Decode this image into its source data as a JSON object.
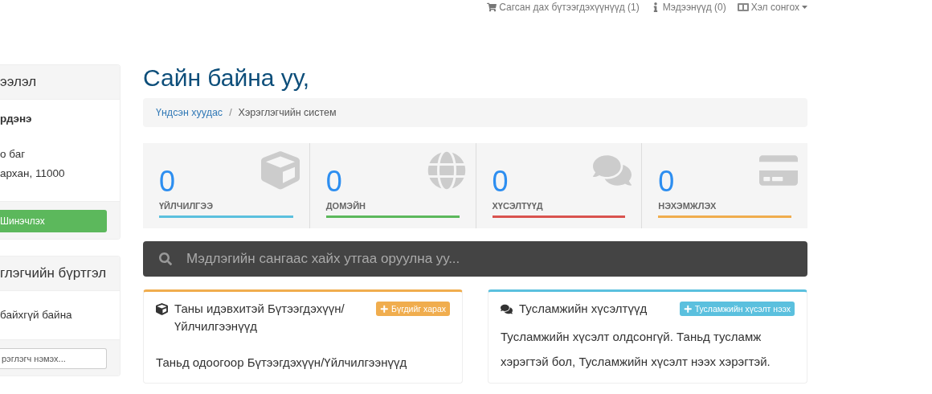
{
  "top_nav": [
    {
      "kind": "cart",
      "label": "Сагсан дах бүтээгдэхүүнүүд (1)"
    },
    {
      "kind": "news",
      "label": "Мэдээнүүд (0)"
    },
    {
      "kind": "language",
      "label": "Хэл сонгох"
    }
  ],
  "sidebar": {
    "info_panel": {
      "title": "ээлэл",
      "lines": [
        "рдэнэ"
      ],
      "address": [
        "о баг",
        "архан, 11000"
      ],
      "button": "Шинэчлэх"
    },
    "contacts_panel": {
      "title": "глэгчийн бүртгэл",
      "body": "байхгүй байна",
      "input_placeholder": "рэглэгч нэмэх..."
    }
  },
  "heading": "Сайн байна уу,",
  "breadcrumb": [
    {
      "label": "Үндсэн хуудас",
      "selected": false
    },
    {
      "separator": "/",
      "label": "Хэрэглэгчийн систем",
      "selected": true
    }
  ],
  "stats": [
    {
      "kind": "box",
      "value": "0",
      "label": "ҮЙЛЧИЛГЭЭ",
      "color": "#5bc0de"
    },
    {
      "kind": "globe",
      "value": "0",
      "label": "ДОМЭЙН",
      "color": "#5cb85c"
    },
    {
      "kind": "chat",
      "value": "0",
      "label": "ХҮСЭЛТҮҮД",
      "color": "#d9534f"
    },
    {
      "kind": "card",
      "value": "0",
      "label": "НЭХЭМЖЛЭХ",
      "color": "#f0ad4e"
    }
  ],
  "search": {
    "placeholder": "Мэдлэгийн сангаас хайх утгаа оруулна уу..."
  },
  "panels": [
    {
      "kind": "products",
      "title": "Таны идэвхитэй Бүтээгдэхүүн/ Үйлчилгээнүүд",
      "button": "Бүгдийг харах",
      "color": "#f0ad4e",
      "body": "Таньд одоогоор Бүтээгдэхүүн/Үйлчилгээнүүд"
    },
    {
      "kind": "tickets",
      "title": "Тусламжийн хүсэлтүүд",
      "button": "Тусламжийн хүсэлт нээх",
      "color": "#5bc0de",
      "body": "Тусламжийн хүсэлт олдсонгүй. Таньд тусламж хэрэгтэй бол, Тусламжийн хүсэлт нээх хэрэгтэй."
    }
  ]
}
